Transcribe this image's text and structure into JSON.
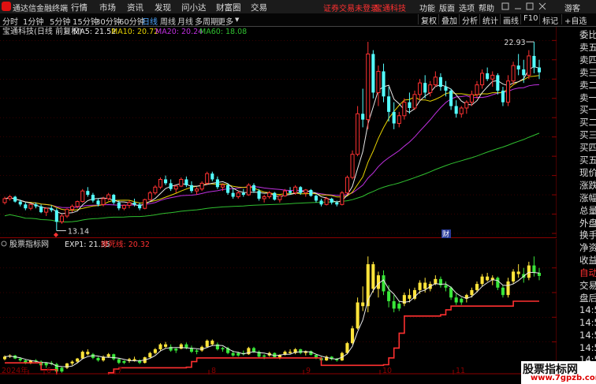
{
  "menubar": {
    "app_name": "通达信金融终端",
    "items": [
      "行情",
      "市场",
      "资讯",
      "发现",
      "问小达",
      "财富圈",
      "交易"
    ],
    "notice": "证券交易未登录",
    "stock": "宝通科技",
    "right_items": [
      "功能",
      "版面",
      "选项",
      "帮助"
    ],
    "guest": "游客"
  },
  "toolbar": {
    "periods": [
      "分时",
      "1分钟",
      "5分钟",
      "15分钟",
      "30分钟",
      "60分钟",
      "日线",
      "周线",
      "月线",
      "多周期",
      "更多"
    ],
    "active": "日线",
    "right_items": [
      "复权",
      "叠加",
      "分析",
      "统计",
      "画线",
      "F10",
      "标记",
      "+自选"
    ]
  },
  "main_chart": {
    "title": "宝通科技(日线 前复权)",
    "ma_labels": [
      {
        "text": "MA5: 21.52",
        "color": "#e8e8e8"
      },
      {
        "text": "MA10: 20.72",
        "color": "#e6d200"
      },
      {
        "text": "MA20: 20.24",
        "color": "#c030e0"
      },
      {
        "text": "MA60: 18.08",
        "color": "#30c030"
      }
    ],
    "y_ticks": [
      "23.00",
      "22.00",
      "21.00",
      "20.00",
      "19.00",
      "18.00",
      "17.00",
      "16.00",
      "15.00",
      "14.00",
      "13.00"
    ],
    "high_label": "22.93",
    "low_label": "13.14",
    "event_marker": "财",
    "left_marker": "◆"
  },
  "indicator_chart": {
    "title": "股票指标网",
    "exp_label": "EXP1: 21.35",
    "exp_color": "#e8e8e8",
    "line_label": "撑死线: 20.32",
    "line_color": "#ff3030",
    "y_ticks": [
      "22.00",
      "20.00",
      "18.00",
      "16.00"
    ]
  },
  "x_axis": {
    "labels": [
      "2024年",
      "6",
      "7",
      "8",
      "9",
      "10",
      "11"
    ]
  },
  "right_panel": {
    "labels": [
      "委比",
      "卖五",
      "卖四",
      "卖三",
      "卖二",
      "卖一",
      "买一",
      "买二",
      "买三",
      "买四",
      "买五",
      "现价",
      "涨跌",
      "涨幅",
      "总量",
      "外盘",
      "换手",
      "净资",
      "收益",
      "自动",
      "交易",
      "盘后",
      "14:56",
      "14:56",
      "14:56",
      "14:56",
      "14:56",
      "14:56",
      "15:00"
    ]
  },
  "watermark": {
    "title": "股票指标网",
    "url": "www.7gpzb.com"
  },
  "chart_data": {
    "type": "candlestick",
    "title": "宝通科技(日线 前复权)",
    "y_range": [
      13.0,
      23.3
    ],
    "ohlc": [
      [
        14.6,
        14.9,
        14.5,
        14.8
      ],
      [
        14.8,
        15.0,
        14.7,
        14.9
      ],
      [
        14.9,
        14.95,
        14.6,
        14.65
      ],
      [
        14.65,
        14.75,
        14.4,
        14.5
      ],
      [
        14.5,
        14.6,
        14.2,
        14.3
      ],
      [
        14.3,
        14.55,
        14.2,
        14.5
      ],
      [
        14.5,
        14.6,
        14.3,
        14.4
      ],
      [
        14.4,
        14.5,
        14.05,
        14.1
      ],
      [
        14.1,
        14.35,
        13.9,
        14.3
      ],
      [
        14.3,
        14.45,
        14.1,
        14.2
      ],
      [
        14.2,
        14.3,
        13.14,
        13.6
      ],
      [
        13.6,
        14.0,
        13.5,
        13.9
      ],
      [
        13.9,
        14.3,
        13.8,
        14.25
      ],
      [
        14.25,
        14.5,
        14.1,
        14.4
      ],
      [
        14.4,
        14.7,
        14.3,
        14.65
      ],
      [
        14.65,
        15.3,
        14.6,
        15.2
      ],
      [
        15.2,
        15.4,
        14.9,
        15.0
      ],
      [
        15.0,
        15.1,
        14.6,
        14.7
      ],
      [
        14.7,
        14.8,
        14.4,
        14.5
      ],
      [
        14.5,
        14.9,
        14.4,
        14.8
      ],
      [
        14.8,
        15.1,
        14.7,
        15.0
      ],
      [
        15.0,
        15.05,
        14.5,
        14.6
      ],
      [
        14.6,
        14.7,
        14.2,
        14.3
      ],
      [
        14.3,
        14.5,
        14.2,
        14.45
      ],
      [
        14.45,
        14.7,
        14.3,
        14.6
      ],
      [
        14.6,
        14.8,
        14.4,
        14.5
      ],
      [
        14.5,
        14.6,
        14.2,
        14.3
      ],
      [
        14.3,
        14.8,
        14.25,
        14.75
      ],
      [
        14.75,
        15.2,
        14.7,
        15.1
      ],
      [
        15.1,
        15.5,
        15.0,
        15.4
      ],
      [
        15.4,
        15.9,
        15.3,
        15.8
      ],
      [
        15.8,
        16.0,
        15.5,
        15.6
      ],
      [
        15.6,
        15.8,
        15.2,
        15.3
      ],
      [
        15.3,
        15.5,
        15.1,
        15.45
      ],
      [
        15.45,
        15.9,
        15.4,
        15.8
      ],
      [
        15.8,
        15.95,
        15.4,
        15.5
      ],
      [
        15.5,
        15.7,
        15.1,
        15.2
      ],
      [
        15.2,
        15.4,
        15.0,
        15.3
      ],
      [
        15.3,
        15.7,
        15.2,
        15.6
      ],
      [
        15.6,
        16.2,
        15.5,
        16.1
      ],
      [
        16.1,
        16.2,
        15.7,
        15.8
      ],
      [
        15.8,
        15.95,
        15.3,
        15.4
      ],
      [
        15.4,
        15.6,
        15.2,
        15.5
      ],
      [
        15.5,
        15.6,
        15.0,
        15.1
      ],
      [
        15.1,
        15.3,
        14.8,
        14.9
      ],
      [
        14.9,
        15.2,
        14.8,
        15.1
      ],
      [
        15.1,
        15.3,
        14.9,
        15.0
      ],
      [
        15.0,
        15.6,
        14.95,
        15.5
      ],
      [
        15.5,
        15.6,
        15.1,
        15.2
      ],
      [
        15.2,
        15.3,
        14.7,
        14.8
      ],
      [
        14.8,
        15.0,
        14.6,
        14.9
      ],
      [
        14.9,
        15.2,
        14.8,
        15.1
      ],
      [
        15.1,
        15.15,
        14.7,
        14.75
      ],
      [
        14.75,
        15.0,
        14.6,
        14.95
      ],
      [
        14.95,
        15.3,
        14.9,
        15.2
      ],
      [
        15.2,
        15.4,
        15.0,
        15.1
      ],
      [
        15.1,
        15.5,
        15.0,
        15.4
      ],
      [
        15.4,
        15.45,
        15.0,
        15.1
      ],
      [
        15.1,
        15.3,
        14.9,
        15.25
      ],
      [
        15.25,
        15.3,
        14.9,
        14.95
      ],
      [
        14.95,
        15.0,
        14.6,
        14.7
      ],
      [
        14.7,
        14.8,
        14.4,
        14.5
      ],
      [
        14.5,
        14.9,
        14.45,
        14.8
      ],
      [
        14.8,
        14.85,
        14.5,
        14.6
      ],
      [
        14.6,
        14.7,
        14.4,
        14.5
      ],
      [
        14.5,
        15.2,
        14.45,
        15.1
      ],
      [
        15.1,
        16.0,
        15.0,
        15.9
      ],
      [
        15.9,
        17.3,
        15.8,
        17.1
      ],
      [
        17.1,
        19.6,
        17.0,
        19.2
      ],
      [
        19.2,
        20.5,
        18.5,
        18.9
      ],
      [
        18.9,
        22.93,
        18.4,
        22.3
      ],
      [
        22.3,
        22.5,
        20.0,
        20.3
      ],
      [
        20.3,
        21.7,
        19.6,
        21.4
      ],
      [
        21.4,
        21.8,
        19.8,
        20.1
      ],
      [
        20.1,
        20.6,
        18.8,
        19.3
      ],
      [
        19.3,
        19.8,
        18.4,
        18.7
      ],
      [
        18.7,
        19.3,
        18.5,
        19.1
      ],
      [
        19.1,
        20.0,
        18.9,
        19.8
      ],
      [
        19.8,
        20.3,
        19.2,
        19.5
      ],
      [
        19.5,
        20.4,
        19.4,
        20.2
      ],
      [
        20.2,
        21.0,
        19.9,
        20.8
      ],
      [
        20.8,
        21.2,
        20.0,
        20.3
      ],
      [
        20.3,
        20.9,
        20.1,
        20.7
      ],
      [
        20.7,
        21.4,
        20.6,
        21.1
      ],
      [
        21.1,
        21.3,
        20.4,
        20.6
      ],
      [
        20.6,
        20.9,
        20.1,
        20.4
      ],
      [
        20.4,
        20.5,
        19.4,
        19.6
      ],
      [
        19.6,
        19.9,
        19.0,
        19.2
      ],
      [
        19.2,
        19.6,
        19.0,
        19.5
      ],
      [
        19.5,
        19.9,
        19.2,
        19.8
      ],
      [
        19.8,
        20.4,
        19.6,
        20.2
      ],
      [
        20.2,
        20.9,
        20.0,
        20.7
      ],
      [
        20.7,
        21.5,
        20.5,
        21.3
      ],
      [
        21.3,
        21.6,
        20.9,
        21.0
      ],
      [
        21.0,
        21.4,
        20.6,
        21.2
      ],
      [
        21.2,
        21.3,
        20.2,
        20.4
      ],
      [
        20.4,
        20.6,
        19.6,
        19.8
      ],
      [
        19.8,
        21.2,
        19.6,
        20.9
      ],
      [
        20.9,
        21.9,
        20.7,
        21.7
      ],
      [
        21.7,
        22.3,
        21.2,
        21.5
      ],
      [
        21.5,
        22.0,
        20.8,
        21.2
      ],
      [
        21.2,
        22.5,
        21.0,
        22.2
      ],
      [
        22.2,
        22.93,
        21.3,
        21.6
      ],
      [
        21.6,
        22.0,
        21.0,
        21.35
      ]
    ],
    "ma5_last": 21.52,
    "ma10_last": 20.72,
    "ma20_last": 20.24,
    "ma60_last": 18.08
  }
}
